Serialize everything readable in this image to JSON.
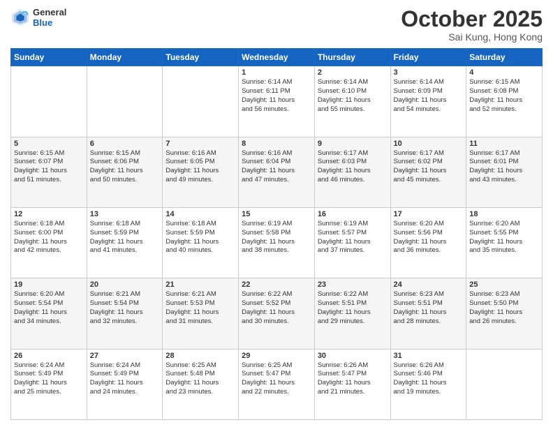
{
  "header": {
    "logo_general": "General",
    "logo_blue": "Blue",
    "month": "October 2025",
    "location": "Sai Kung, Hong Kong"
  },
  "weekdays": [
    "Sunday",
    "Monday",
    "Tuesday",
    "Wednesday",
    "Thursday",
    "Friday",
    "Saturday"
  ],
  "weeks": [
    [
      {
        "day": "",
        "info": ""
      },
      {
        "day": "",
        "info": ""
      },
      {
        "day": "",
        "info": ""
      },
      {
        "day": "1",
        "info": "Sunrise: 6:14 AM\nSunset: 6:11 PM\nDaylight: 11 hours\nand 56 minutes."
      },
      {
        "day": "2",
        "info": "Sunrise: 6:14 AM\nSunset: 6:10 PM\nDaylight: 11 hours\nand 55 minutes."
      },
      {
        "day": "3",
        "info": "Sunrise: 6:14 AM\nSunset: 6:09 PM\nDaylight: 11 hours\nand 54 minutes."
      },
      {
        "day": "4",
        "info": "Sunrise: 6:15 AM\nSunset: 6:08 PM\nDaylight: 11 hours\nand 52 minutes."
      }
    ],
    [
      {
        "day": "5",
        "info": "Sunrise: 6:15 AM\nSunset: 6:07 PM\nDaylight: 11 hours\nand 51 minutes."
      },
      {
        "day": "6",
        "info": "Sunrise: 6:15 AM\nSunset: 6:06 PM\nDaylight: 11 hours\nand 50 minutes."
      },
      {
        "day": "7",
        "info": "Sunrise: 6:16 AM\nSunset: 6:05 PM\nDaylight: 11 hours\nand 49 minutes."
      },
      {
        "day": "8",
        "info": "Sunrise: 6:16 AM\nSunset: 6:04 PM\nDaylight: 11 hours\nand 47 minutes."
      },
      {
        "day": "9",
        "info": "Sunrise: 6:17 AM\nSunset: 6:03 PM\nDaylight: 11 hours\nand 46 minutes."
      },
      {
        "day": "10",
        "info": "Sunrise: 6:17 AM\nSunset: 6:02 PM\nDaylight: 11 hours\nand 45 minutes."
      },
      {
        "day": "11",
        "info": "Sunrise: 6:17 AM\nSunset: 6:01 PM\nDaylight: 11 hours\nand 43 minutes."
      }
    ],
    [
      {
        "day": "12",
        "info": "Sunrise: 6:18 AM\nSunset: 6:00 PM\nDaylight: 11 hours\nand 42 minutes."
      },
      {
        "day": "13",
        "info": "Sunrise: 6:18 AM\nSunset: 5:59 PM\nDaylight: 11 hours\nand 41 minutes."
      },
      {
        "day": "14",
        "info": "Sunrise: 6:18 AM\nSunset: 5:59 PM\nDaylight: 11 hours\nand 40 minutes."
      },
      {
        "day": "15",
        "info": "Sunrise: 6:19 AM\nSunset: 5:58 PM\nDaylight: 11 hours\nand 38 minutes."
      },
      {
        "day": "16",
        "info": "Sunrise: 6:19 AM\nSunset: 5:57 PM\nDaylight: 11 hours\nand 37 minutes."
      },
      {
        "day": "17",
        "info": "Sunrise: 6:20 AM\nSunset: 5:56 PM\nDaylight: 11 hours\nand 36 minutes."
      },
      {
        "day": "18",
        "info": "Sunrise: 6:20 AM\nSunset: 5:55 PM\nDaylight: 11 hours\nand 35 minutes."
      }
    ],
    [
      {
        "day": "19",
        "info": "Sunrise: 6:20 AM\nSunset: 5:54 PM\nDaylight: 11 hours\nand 34 minutes."
      },
      {
        "day": "20",
        "info": "Sunrise: 6:21 AM\nSunset: 5:54 PM\nDaylight: 11 hours\nand 32 minutes."
      },
      {
        "day": "21",
        "info": "Sunrise: 6:21 AM\nSunset: 5:53 PM\nDaylight: 11 hours\nand 31 minutes."
      },
      {
        "day": "22",
        "info": "Sunrise: 6:22 AM\nSunset: 5:52 PM\nDaylight: 11 hours\nand 30 minutes."
      },
      {
        "day": "23",
        "info": "Sunrise: 6:22 AM\nSunset: 5:51 PM\nDaylight: 11 hours\nand 29 minutes."
      },
      {
        "day": "24",
        "info": "Sunrise: 6:23 AM\nSunset: 5:51 PM\nDaylight: 11 hours\nand 28 minutes."
      },
      {
        "day": "25",
        "info": "Sunrise: 6:23 AM\nSunset: 5:50 PM\nDaylight: 11 hours\nand 26 minutes."
      }
    ],
    [
      {
        "day": "26",
        "info": "Sunrise: 6:24 AM\nSunset: 5:49 PM\nDaylight: 11 hours\nand 25 minutes."
      },
      {
        "day": "27",
        "info": "Sunrise: 6:24 AM\nSunset: 5:49 PM\nDaylight: 11 hours\nand 24 minutes."
      },
      {
        "day": "28",
        "info": "Sunrise: 6:25 AM\nSunset: 5:48 PM\nDaylight: 11 hours\nand 23 minutes."
      },
      {
        "day": "29",
        "info": "Sunrise: 6:25 AM\nSunset: 5:47 PM\nDaylight: 11 hours\nand 22 minutes."
      },
      {
        "day": "30",
        "info": "Sunrise: 6:26 AM\nSunset: 5:47 PM\nDaylight: 11 hours\nand 21 minutes."
      },
      {
        "day": "31",
        "info": "Sunrise: 6:26 AM\nSunset: 5:46 PM\nDaylight: 11 hours\nand 19 minutes."
      },
      {
        "day": "",
        "info": ""
      }
    ]
  ]
}
